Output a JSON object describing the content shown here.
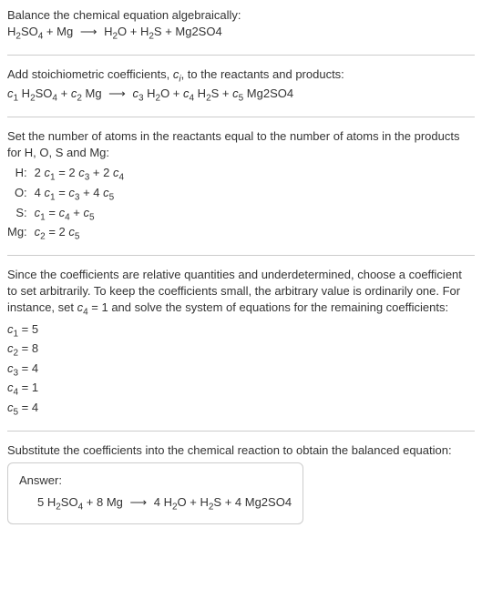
{
  "intro": {
    "line1": "Balance the chemical equation algebraically:",
    "eq_h2so4": "H",
    "eq_2a": "2",
    "eq_so4": "SO",
    "eq_4a": "4",
    "eq_plus1": " + Mg ",
    "eq_arrow": "⟶",
    "eq_h2o": " H",
    "eq_2b": "2",
    "eq_o": "O + H",
    "eq_2c": "2",
    "eq_s": "S + Mg2SO4"
  },
  "section2": {
    "text_a": "Add stoichiometric coefficients, ",
    "ci_c": "c",
    "ci_i": "i",
    "text_b": ", to the reactants and products:",
    "c1": "c",
    "n1": "1",
    "sp1": " H",
    "s2": "2",
    "sp2": "SO",
    "s4": "4",
    "sp3": " + ",
    "c2": "c",
    "n2": "2",
    "sp4": " Mg ",
    "arrow": "⟶",
    "sp5": " ",
    "c3": "c",
    "n3": "3",
    "sp6": " H",
    "s2b": "2",
    "sp7": "O + ",
    "c4": "c",
    "n4": "4",
    "sp8": " H",
    "s2c": "2",
    "sp9": "S + ",
    "c5": "c",
    "n5": "5",
    "sp10": " Mg2SO4"
  },
  "section3": {
    "text": "Set the number of atoms in the reactants equal to the number of atoms in the products for H, O, S and Mg:",
    "rows": [
      {
        "label": "H:",
        "c": "c",
        "eq": "2 c₁ = 2 c₃ + 2 c₄"
      },
      {
        "label": "O:",
        "c": "c",
        "eq": "4 c₁ = c₃ + 4 c₅"
      },
      {
        "label": "S:",
        "c": "c",
        "eq": "c₁ = c₄ + c₅"
      },
      {
        "label": "Mg:",
        "c": "c",
        "eq": "c₂ = 2 c₅"
      }
    ],
    "h_label": "H:",
    "h_eq_a": "2 ",
    "h_c1": "c",
    "h_1": "1",
    "h_eq_b": " = 2 ",
    "h_c3": "c",
    "h_3": "3",
    "h_eq_c": " + 2 ",
    "h_c4": "c",
    "h_4": "4",
    "o_label": "O:",
    "o_eq_a": "4 ",
    "o_c1": "c",
    "o_1": "1",
    "o_eq_b": " = ",
    "o_c3": "c",
    "o_3": "3",
    "o_eq_c": " + 4 ",
    "o_c5": "c",
    "o_5": "5",
    "s_label": "S:",
    "s_c1": "c",
    "s_1": "1",
    "s_eq_b": " = ",
    "s_c4": "c",
    "s_4": "4",
    "s_eq_c": " + ",
    "s_c5": "c",
    "s_5": "5",
    "mg_label": "Mg:",
    "mg_c2": "c",
    "mg_2": "2",
    "mg_eq_b": " = 2 ",
    "mg_c5": "c",
    "mg_5": "5"
  },
  "section4": {
    "text_a": "Since the coefficients are relative quantities and underdetermined, choose a coefficient to set arbitrarily. To keep the coefficients small, the arbitrary value is ordinarily one. For instance, set ",
    "c4c": "c",
    "c4n": "4",
    "text_b": " = 1 and solve the system of equations for the remaining coefficients:",
    "r1c": "c",
    "r1n": "1",
    "r1v": " = 5",
    "r2c": "c",
    "r2n": "2",
    "r2v": " = 8",
    "r3c": "c",
    "r3n": "3",
    "r3v": " = 4",
    "r4c": "c",
    "r4n": "4",
    "r4v": " = 1",
    "r5c": "c",
    "r5n": "5",
    "r5v": " = 4"
  },
  "section5": {
    "text": "Substitute the coefficients into the chemical reaction to obtain the balanced equation:",
    "answer_label": "Answer:",
    "eq_a": "5 H",
    "eq_2a": "2",
    "eq_b": "SO",
    "eq_4a": "4",
    "eq_c": " + 8 Mg ",
    "arrow": "⟶",
    "eq_d": " 4 H",
    "eq_2b": "2",
    "eq_e": "O + H",
    "eq_2c": "2",
    "eq_f": "S + 4 Mg2SO4"
  }
}
